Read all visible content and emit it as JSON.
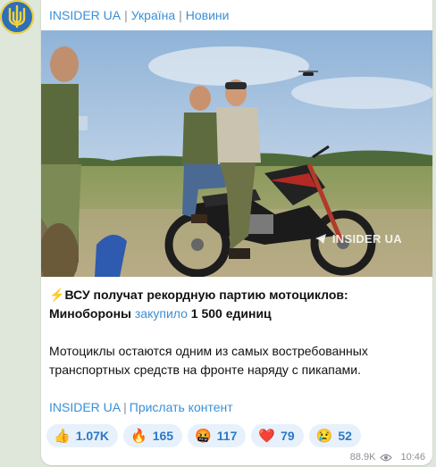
{
  "channel": {
    "name": "INSIDER UA",
    "tags": [
      "Україна",
      "Новини"
    ]
  },
  "photo": {
    "watermark": "INSIDER UA"
  },
  "post": {
    "title_prefix": "⚡️",
    "title_text": "ВСУ получат рекордную партию мотоциклов: Минобороны ",
    "title_link": "закупило",
    "title_suffix": " 1 500 единиц",
    "paragraph": "Мотоциклы остаются одним из самых востребованных транспортных средств на фронте наряду с пикапами.",
    "footer_link_1": "INSIDER UA",
    "footer_link_2": "Прислать контент"
  },
  "reactions": [
    {
      "emoji": "👍",
      "count": "1.07K"
    },
    {
      "emoji": "🔥",
      "count": "165"
    },
    {
      "emoji": "🤬",
      "count": "117"
    },
    {
      "emoji": "❤️",
      "count": "79"
    },
    {
      "emoji": "😢",
      "count": "52"
    }
  ],
  "meta": {
    "views": "88.9K",
    "time": "10:46"
  },
  "colors": {
    "accent": "#3a8fd6",
    "reaction_bg": "#e7f1fb",
    "chat_bg": "#dfe7da"
  }
}
